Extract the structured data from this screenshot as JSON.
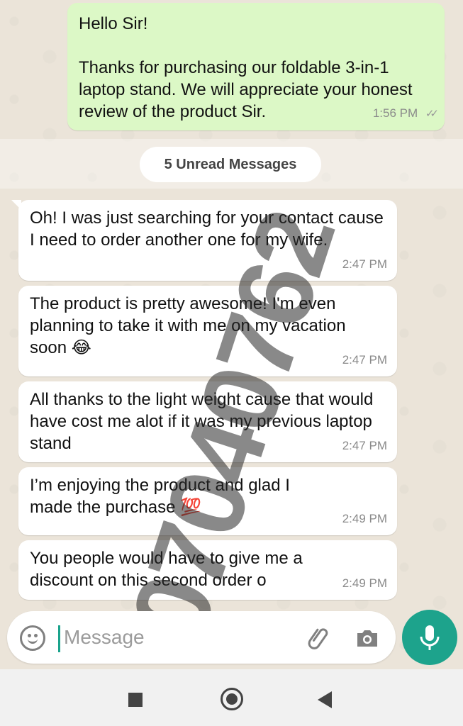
{
  "outgoing_message": {
    "text": "Hello Sir!\n\nThanks for purchasing our foldable 3-in-1 laptop stand. We will appreciate your honest review of the product Sir.",
    "time": "1:56 PM",
    "status": "double-check-icon"
  },
  "unread_banner": "5 Unread Messages",
  "incoming_messages": [
    {
      "text": "Oh! I was just searching for your contact cause I need to order another one for my wife.",
      "time": "2:47 PM"
    },
    {
      "text": "The product is pretty awesome! I'm even planning to take it with me on my vacation soon 😂",
      "time": "2:47 PM"
    },
    {
      "text": "All thanks to the light weight cause that would have cost me alot if it was my previous laptop stand",
      "time": "2:47 PM"
    },
    {
      "text": "I’m enjoying the product and glad I made the purchase 💯",
      "time": "2:49 PM"
    },
    {
      "text": "You people would have to give me a discount on this second order o",
      "time": "2:49 PM"
    }
  ],
  "watermark": "07040762",
  "composer": {
    "placeholder": "Message",
    "icons": [
      "emoji-icon",
      "attach-icon",
      "camera-icon",
      "mic-icon"
    ]
  },
  "navbar": {
    "icons": [
      "recent-apps-icon",
      "home-icon",
      "back-icon"
    ]
  },
  "colors": {
    "outgoing_bubble": "#dcf8c6",
    "incoming_bubble": "#ffffff",
    "chat_background": "#ebe4d9",
    "accent": "#1da38c"
  }
}
